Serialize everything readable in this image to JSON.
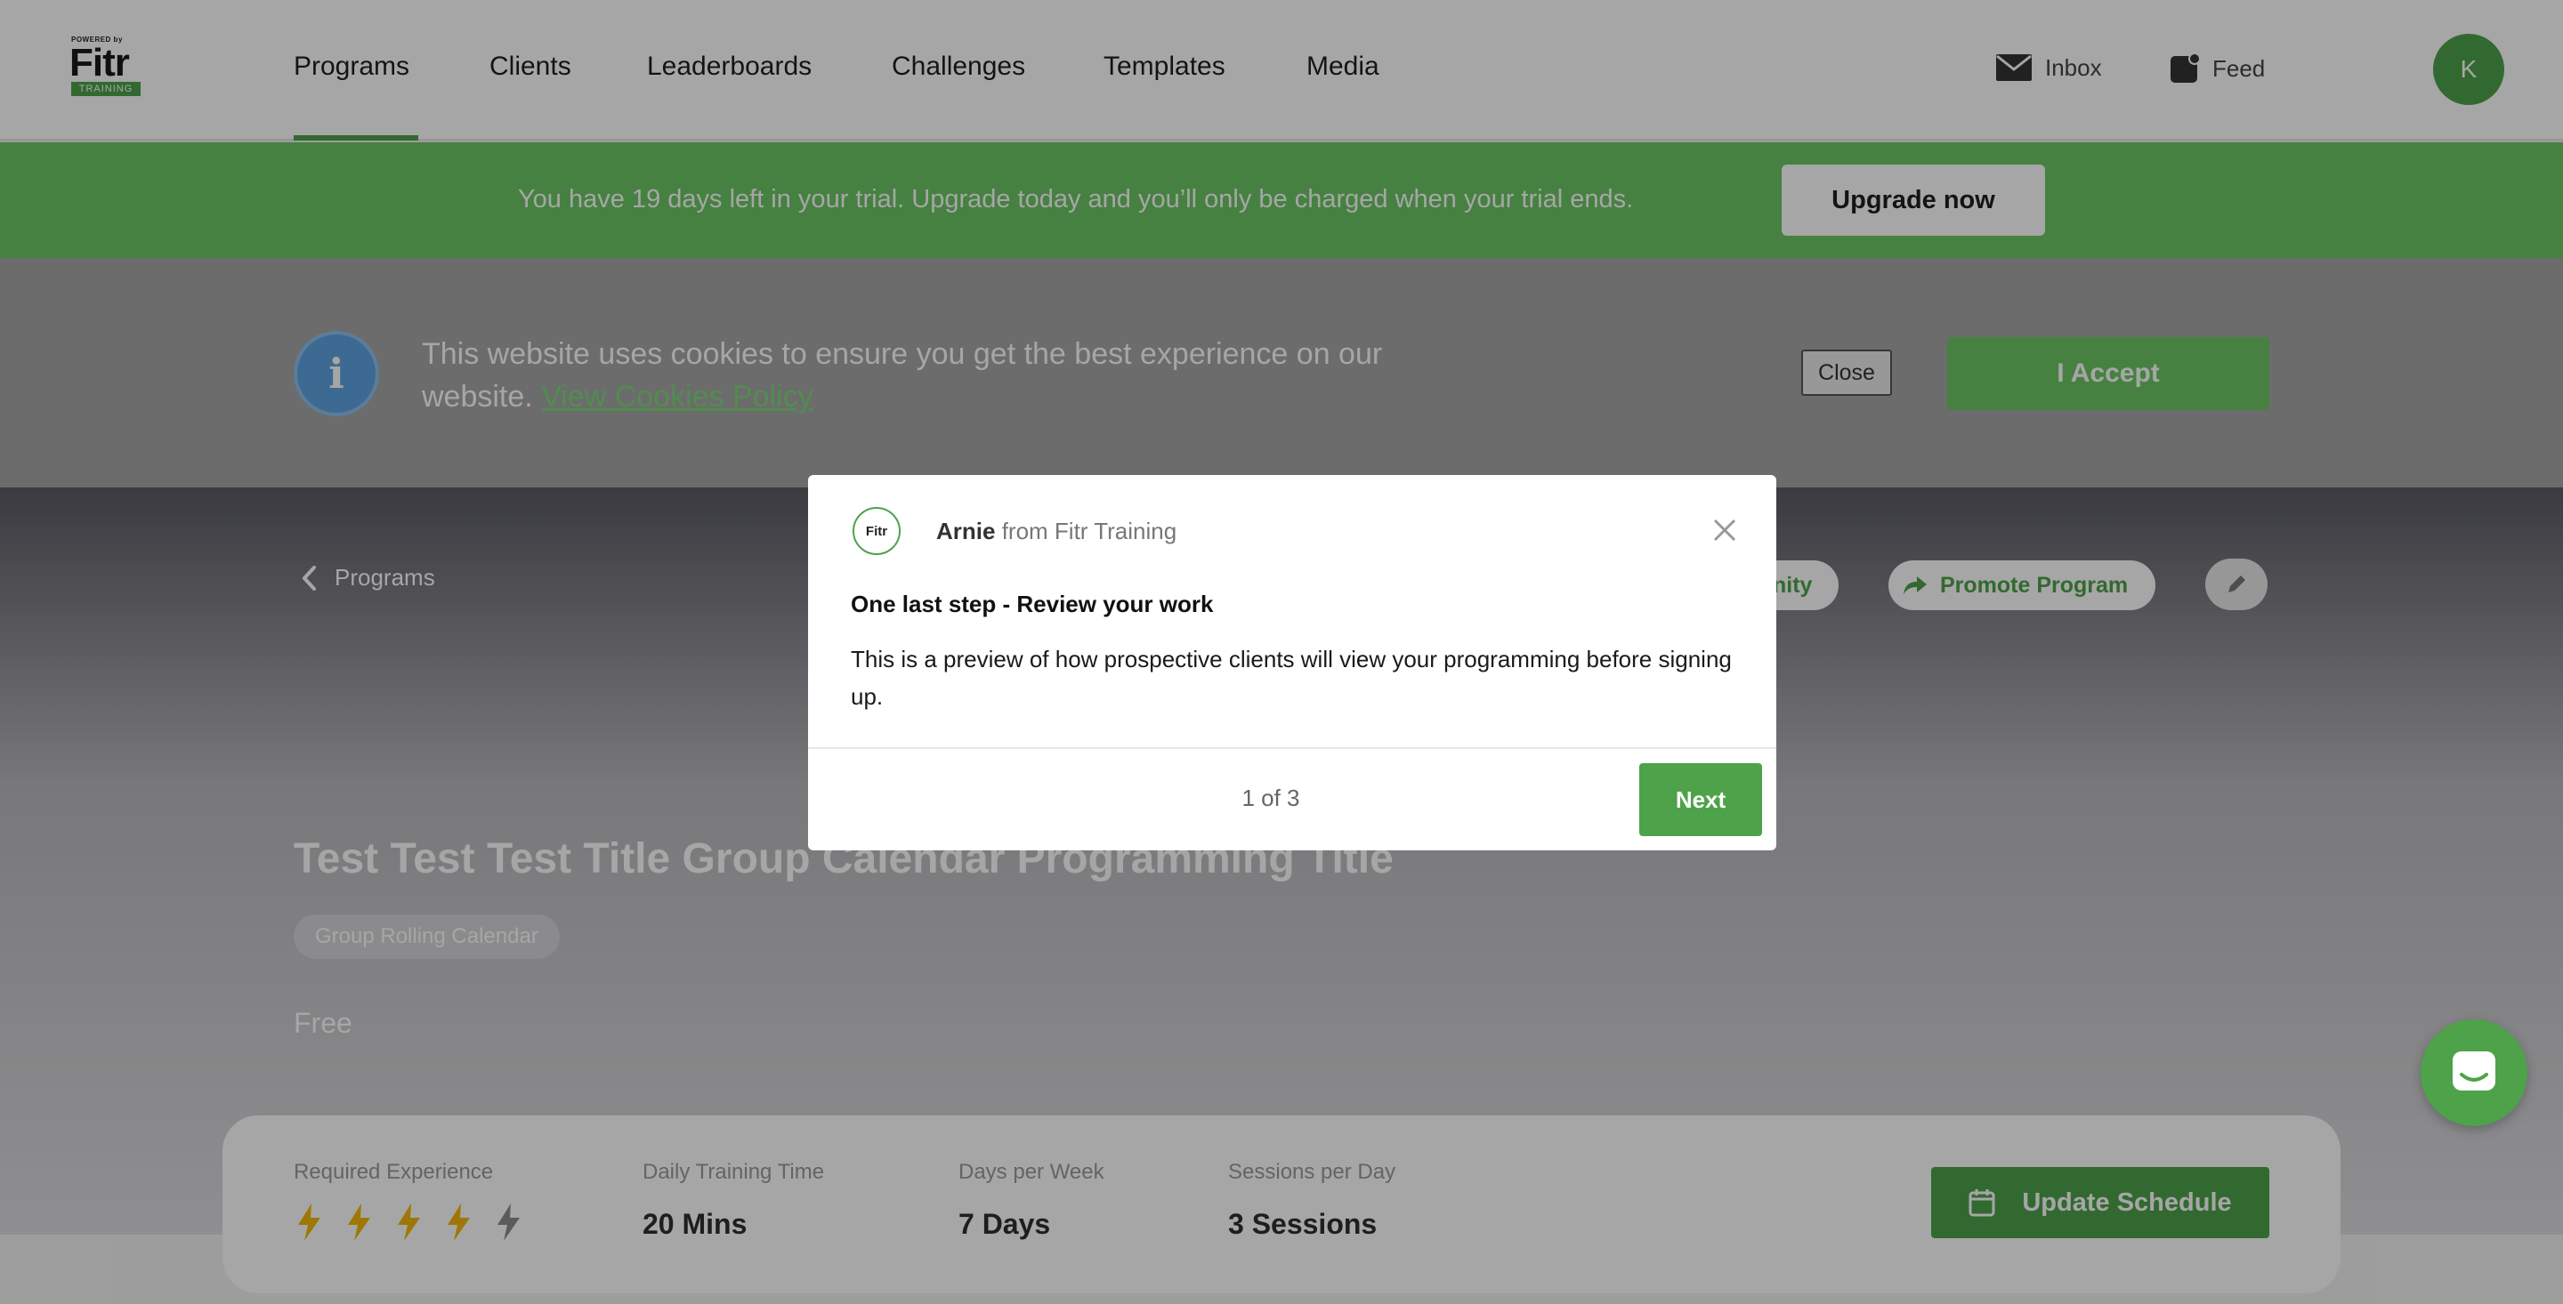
{
  "brand": {
    "logo_powered": "POWERED by",
    "logo_word": "Fitr",
    "logo_sub": "TRAINING",
    "accent_color": "#4ea24a"
  },
  "nav": {
    "items": [
      {
        "label": "Programs",
        "active": true
      },
      {
        "label": "Clients"
      },
      {
        "label": "Leaderboards"
      },
      {
        "label": "Challenges"
      },
      {
        "label": "Templates"
      },
      {
        "label": "Media"
      }
    ],
    "inbox_label": "Inbox",
    "feed_label": "Feed",
    "avatar_initial": "K"
  },
  "trial_banner": {
    "text": "You have 19 days left in your trial. Upgrade today and you’ll only be charged when your trial ends.",
    "button": "Upgrade now"
  },
  "cookie_bar": {
    "text": "This website uses cookies to ensure you get the best experience on our website.",
    "link": "View Cookies Policy",
    "close": "Close",
    "accept": "I Accept"
  },
  "program": {
    "back_label": "Programs",
    "community_label": "nity",
    "promote_label": "Promote Program",
    "title": "Test Test Test Title Group Calendar Programming Title",
    "tag": "Group Rolling Calendar",
    "price": "Free",
    "stats": {
      "experience_label": "Required Experience",
      "experience_level": 4,
      "experience_max": 5,
      "training_time_label": "Daily Training Time",
      "training_time": "20 Mins",
      "days_label": "Days per Week",
      "days": "7 Days",
      "sessions_label": "Sessions per Day",
      "sessions": "3 Sessions"
    },
    "update_schedule": "Update Schedule"
  },
  "tour": {
    "sender": "Arnie",
    "from": "from Fitr Training",
    "logo_text": "Fitr",
    "heading": "One last step - Review your work",
    "body": "This is a preview of how prospective clients will view your programming before signing up.",
    "step": "1 of 3",
    "next": "Next"
  }
}
